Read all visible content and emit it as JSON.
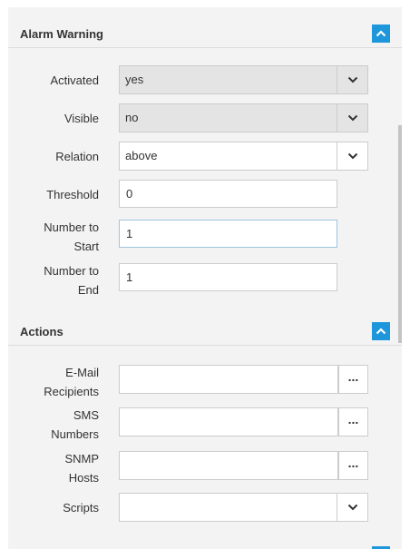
{
  "alarm_warning": {
    "title": "Alarm Warning",
    "activated": {
      "label": "Activated",
      "value": "yes"
    },
    "visible": {
      "label": "Visible",
      "value": "no"
    },
    "relation": {
      "label": "Relation",
      "value": "above"
    },
    "threshold": {
      "label": "Threshold",
      "value": "0"
    },
    "number_to_start": {
      "label_line1": "Number to",
      "label_line2": "Start",
      "value": "1"
    },
    "number_to_end": {
      "label_line1": "Number to",
      "label_line2": "End",
      "value": "1"
    }
  },
  "actions": {
    "title": "Actions",
    "email": {
      "label_line1": "E-Mail",
      "label_line2": "Recipients",
      "value": "",
      "button": "..."
    },
    "sms": {
      "label_line1": "SMS",
      "label_line2": "Numbers",
      "value": "",
      "button": "..."
    },
    "snmp": {
      "label_line1": "SNMP",
      "label_line2": "Hosts",
      "value": "",
      "button": "..."
    },
    "scripts": {
      "label": "Scripts",
      "value": ""
    }
  },
  "icons": {
    "collapse": "chevron-up-icon",
    "dropdown": "chevron-down-icon",
    "picker": "ellipsis-icon"
  },
  "colors": {
    "accent": "#1e96dc",
    "panel": "#f3f3f3",
    "readonly_field": "#e4e4e4"
  }
}
